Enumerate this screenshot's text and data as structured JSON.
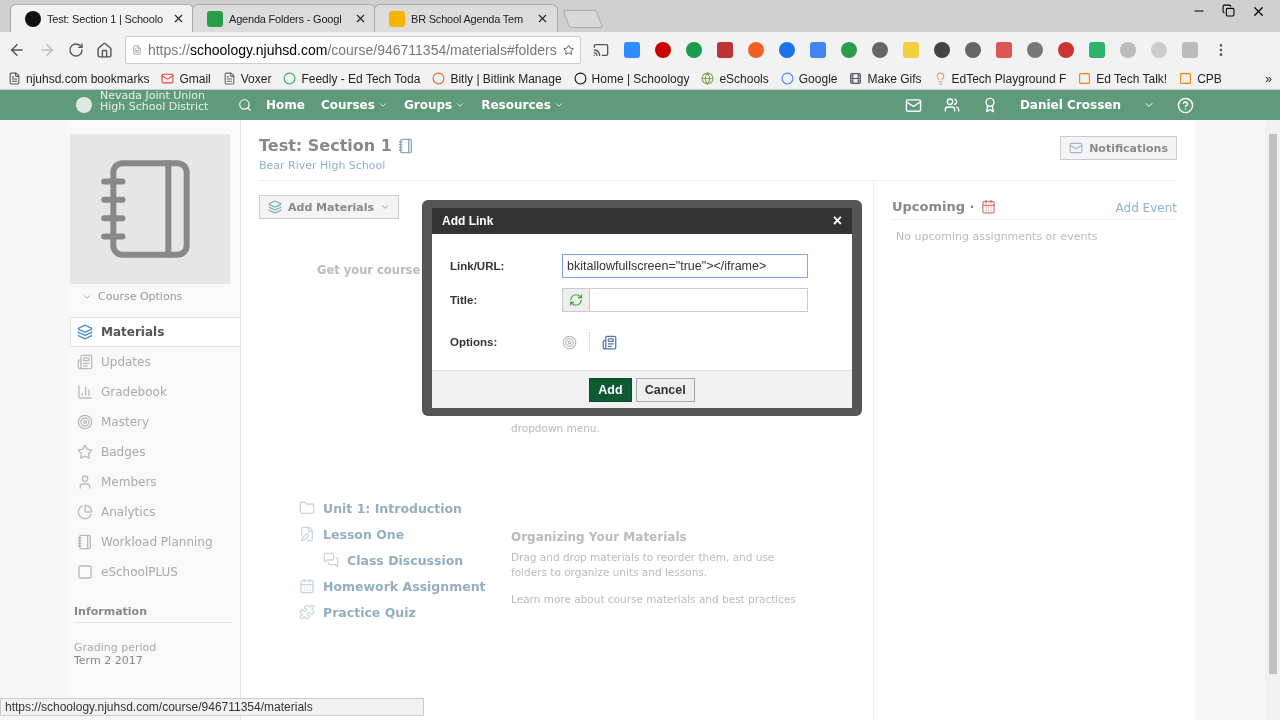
{
  "browser": {
    "tabs": [
      {
        "title": "Test: Section 1 | Schoolo",
        "kind": "schoology",
        "selected": true
      },
      {
        "title": "Agenda Folders - Googl",
        "kind": "drive",
        "selected": false
      },
      {
        "title": "BR School Agenda Tem",
        "kind": "slides",
        "selected": false
      }
    ],
    "url": {
      "scheme": "https://",
      "host": "schoology.njuhsd.com",
      "path": "/course/946711354/materials#folders"
    },
    "bookmarks": [
      {
        "label": "njuhsd.com bookmarks",
        "kind": "folder"
      },
      {
        "label": "Gmail",
        "kind": "gmail"
      },
      {
        "label": "Voxer",
        "kind": "page"
      },
      {
        "label": "Feedly - Ed Tech Toda",
        "kind": "feedly"
      },
      {
        "label": "Bitly | Bitlink Manage",
        "kind": "bitly"
      },
      {
        "label": "Home | Schoology",
        "kind": "schoology"
      },
      {
        "label": "eSchools",
        "kind": "globe"
      },
      {
        "label": "Google",
        "kind": "google"
      },
      {
        "label": "Make Gifs",
        "kind": "film"
      },
      {
        "label": "EdTech Playground F",
        "kind": "bulb"
      },
      {
        "label": "Ed Tech Talk!",
        "kind": "blogger"
      },
      {
        "label": "CPB",
        "kind": "blogger"
      }
    ],
    "more": "»"
  },
  "header": {
    "logo": [
      "Nevada Joint Union",
      "High School District"
    ],
    "nav": [
      {
        "label": "Home",
        "menu": false
      },
      {
        "label": "Courses",
        "menu": true
      },
      {
        "label": "Groups",
        "menu": true
      },
      {
        "label": "Resources",
        "menu": true
      }
    ],
    "user": "Daniel Crossen"
  },
  "sidebar": {
    "course_options": "Course Options",
    "items": [
      {
        "label": "Materials",
        "kind": "materials",
        "selected": true
      },
      {
        "label": "Updates",
        "kind": "updates",
        "selected": false
      },
      {
        "label": "Gradebook",
        "kind": "gradebook",
        "selected": false
      },
      {
        "label": "Mastery",
        "kind": "mastery",
        "selected": false
      },
      {
        "label": "Badges",
        "kind": "badges",
        "selected": false
      },
      {
        "label": "Members",
        "kind": "members",
        "selected": false
      },
      {
        "label": "Analytics",
        "kind": "analytics",
        "selected": false
      },
      {
        "label": "Workload Planning",
        "kind": "workload",
        "selected": false
      },
      {
        "label": "eSchoolPLUS",
        "kind": "eschool",
        "selected": false
      }
    ],
    "information": "Information",
    "grading_label": "Grading period",
    "grading_value": "Term 2 2017"
  },
  "course": {
    "title": "Test: Section 1",
    "school": "Bear River High School",
    "notifications": "Notifications",
    "add_materials": "Add Materials"
  },
  "empty_state": {
    "heading": "Get your course",
    "hint": "dropdown menu.",
    "materials": [
      {
        "label": "Unit 1: Introduction",
        "kind": "folder"
      },
      {
        "label": "Lesson One",
        "kind": "page",
        "children": [
          {
            "label": "Class Discussion",
            "kind": "discussion"
          }
        ]
      },
      {
        "label": "Homework Assignment",
        "kind": "assignment"
      },
      {
        "label": "Practice Quiz",
        "kind": "quiz"
      }
    ],
    "organizing_title": "Organizing Your Materials",
    "organizing_text": "Drag and drop materials to reorder them, and use folders to organize units and lessons.",
    "learn_more": "Learn more about course materials and best practices"
  },
  "upcoming": {
    "title": "Upcoming ·",
    "add_event": "Add Event",
    "empty": "No upcoming assignments or events"
  },
  "dialog": {
    "title": "Add Link",
    "close": "×",
    "fields": [
      {
        "label": "Link/URL:",
        "kind": "text",
        "value": "bkitallowfullscreen=\"true\"></iframe>"
      },
      {
        "label": "Title:",
        "kind": "refresh"
      }
    ],
    "options_label": "Options:",
    "buttons": [
      {
        "label": "Add",
        "kind": "primary"
      },
      {
        "label": "Cancel",
        "kind": "secondary"
      }
    ]
  },
  "status_bar": "https://schoology.njuhsd.com/course/946711354/materials"
}
